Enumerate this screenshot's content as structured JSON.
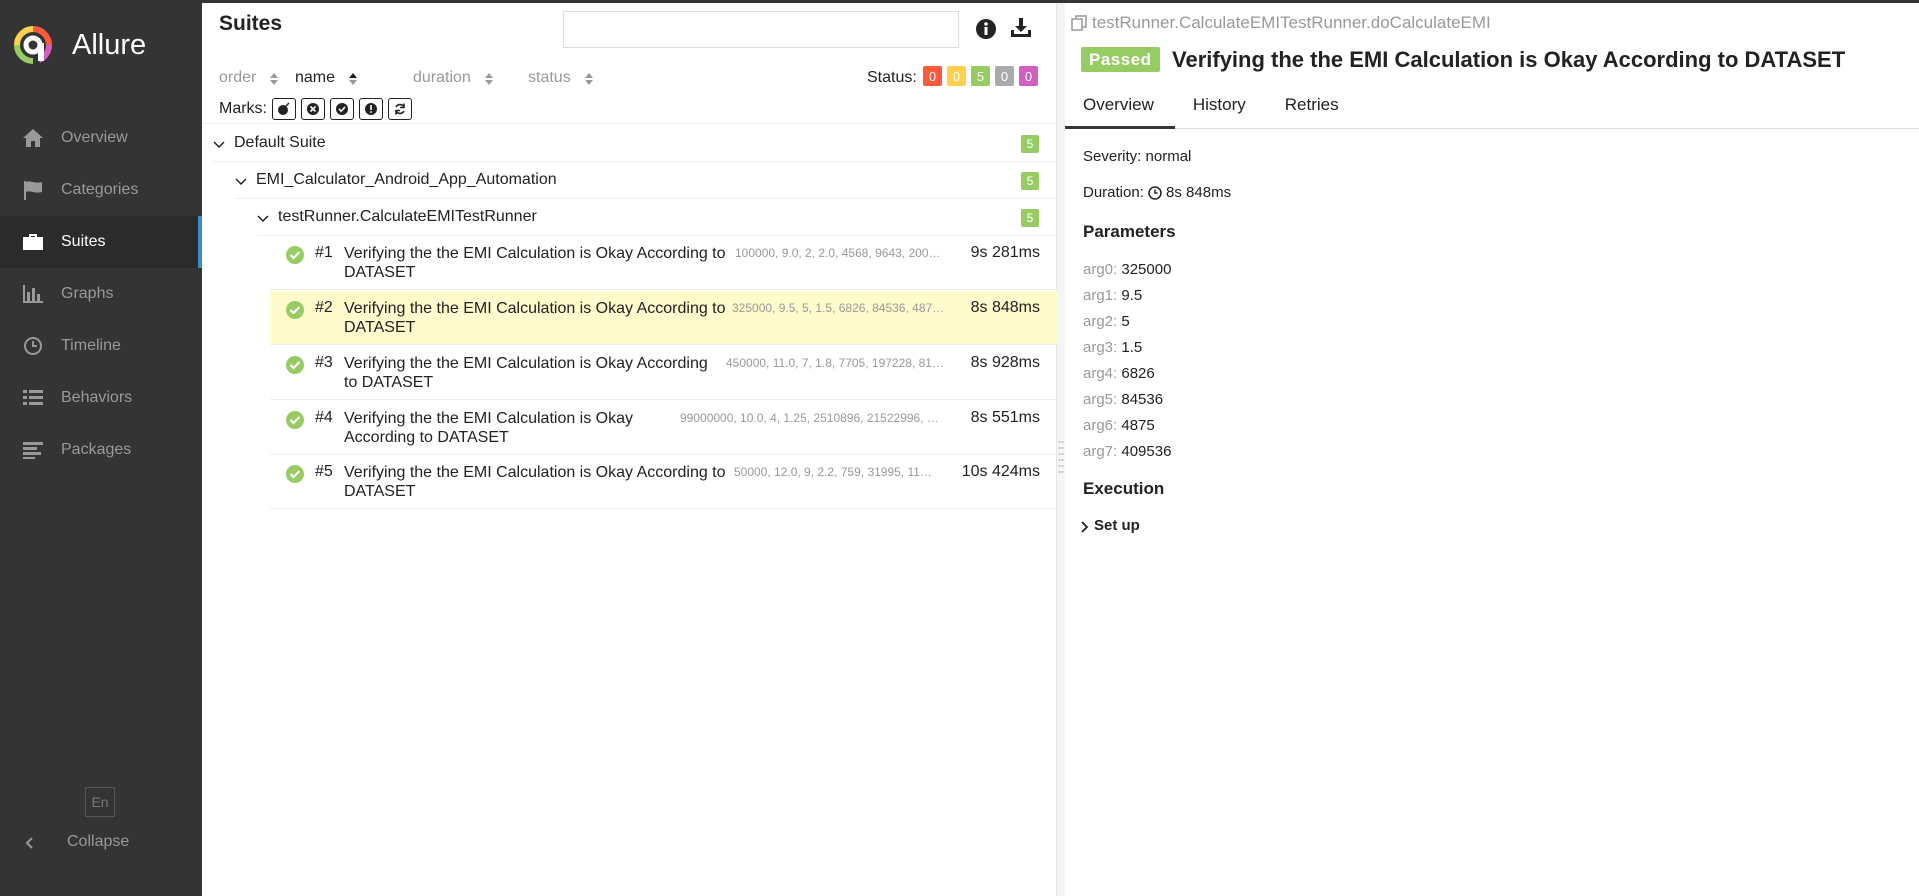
{
  "app": {
    "name": "Allure"
  },
  "sidebar": {
    "items": [
      {
        "label": "Overview",
        "icon": "home-icon"
      },
      {
        "label": "Categories",
        "icon": "flag-icon"
      },
      {
        "label": "Suites",
        "icon": "briefcase-icon"
      },
      {
        "label": "Graphs",
        "icon": "bar-chart-icon"
      },
      {
        "label": "Timeline",
        "icon": "clock-icon"
      },
      {
        "label": "Behaviors",
        "icon": "list-icon"
      },
      {
        "label": "Packages",
        "icon": "align-left-icon"
      }
    ],
    "active": "Suites",
    "language": "En",
    "collapse_label": "Collapse"
  },
  "suites": {
    "title": "Suites",
    "search_placeholder": "",
    "sort": {
      "order": "order",
      "name": "name",
      "duration": "duration",
      "status": "status",
      "current": "name"
    },
    "status_label": "Status:",
    "status_counts": [
      {
        "value": "0",
        "color": "#fd5a3e"
      },
      {
        "value": "0",
        "color": "#ffd050"
      },
      {
        "value": "5",
        "color": "#97cc64"
      },
      {
        "value": "0",
        "color": "#aaaaaa"
      },
      {
        "value": "0",
        "color": "#d35ebe"
      }
    ],
    "marks_label": "Marks:",
    "tree": {
      "suite": {
        "label": "Default Suite",
        "count": "5"
      },
      "package": {
        "label": "EMI_Calculator_Android_App_Automation",
        "count": "5"
      },
      "class": {
        "label": "testRunner.CalculateEMITestRunner",
        "count": "5"
      }
    },
    "tests": [
      {
        "num": "#1",
        "name_line1": "Verifying the the EMI Calculation is Okay According to",
        "name_line2": "DATASET",
        "params": "100000, 9.0, 2, 2.0, 4568, 9643, 200…",
        "duration": "9s 281ms"
      },
      {
        "num": "#2",
        "name_line1": "Verifying the the EMI Calculation is Okay According to",
        "name_line2": "DATASET",
        "params": "325000, 9.5, 5, 1.5, 6826, 84536, 487…",
        "duration": "8s 848ms"
      },
      {
        "num": "#3",
        "name_line1": "Verifying the the EMI Calculation is Okay According",
        "name_line2": "to DATASET",
        "params": "450000, 11.0, 7, 1.8, 7705, 197228, 81…",
        "duration": "8s 928ms"
      },
      {
        "num": "#4",
        "name_line1": "Verifying the the EMI Calculation is Okay",
        "name_line2": "According to DATASET",
        "params": "99000000, 10.0, 4, 1.25, 2510896, 21522996, …",
        "duration": "8s 551ms"
      },
      {
        "num": "#5",
        "name_line1": "Verifying the the EMI Calculation is Okay According to",
        "name_line2": "DATASET",
        "params": "50000, 12.0, 9, 2.2, 759, 31995, 11…",
        "duration": "10s 424ms"
      }
    ]
  },
  "details": {
    "breadcrumb": "testRunner.CalculateEMITestRunner.doCalculateEMI",
    "status": "Passed",
    "title": "Verifying the the EMI Calculation is Okay According to DATASET",
    "tabs": [
      "Overview",
      "History",
      "Retries"
    ],
    "severity_label": "Severity:",
    "severity_value": "normal",
    "duration_label": "Duration:",
    "duration_value": "8s 848ms",
    "parameters_heading": "Parameters",
    "parameters": [
      {
        "key": "arg0:",
        "value": "325000"
      },
      {
        "key": "arg1:",
        "value": "9.5"
      },
      {
        "key": "arg2:",
        "value": "5"
      },
      {
        "key": "arg3:",
        "value": "1.5"
      },
      {
        "key": "arg4:",
        "value": "6826"
      },
      {
        "key": "arg5:",
        "value": "84536"
      },
      {
        "key": "arg6:",
        "value": "4875"
      },
      {
        "key": "arg7:",
        "value": "409536"
      }
    ],
    "execution_heading": "Execution",
    "setup_label": "Set up"
  }
}
